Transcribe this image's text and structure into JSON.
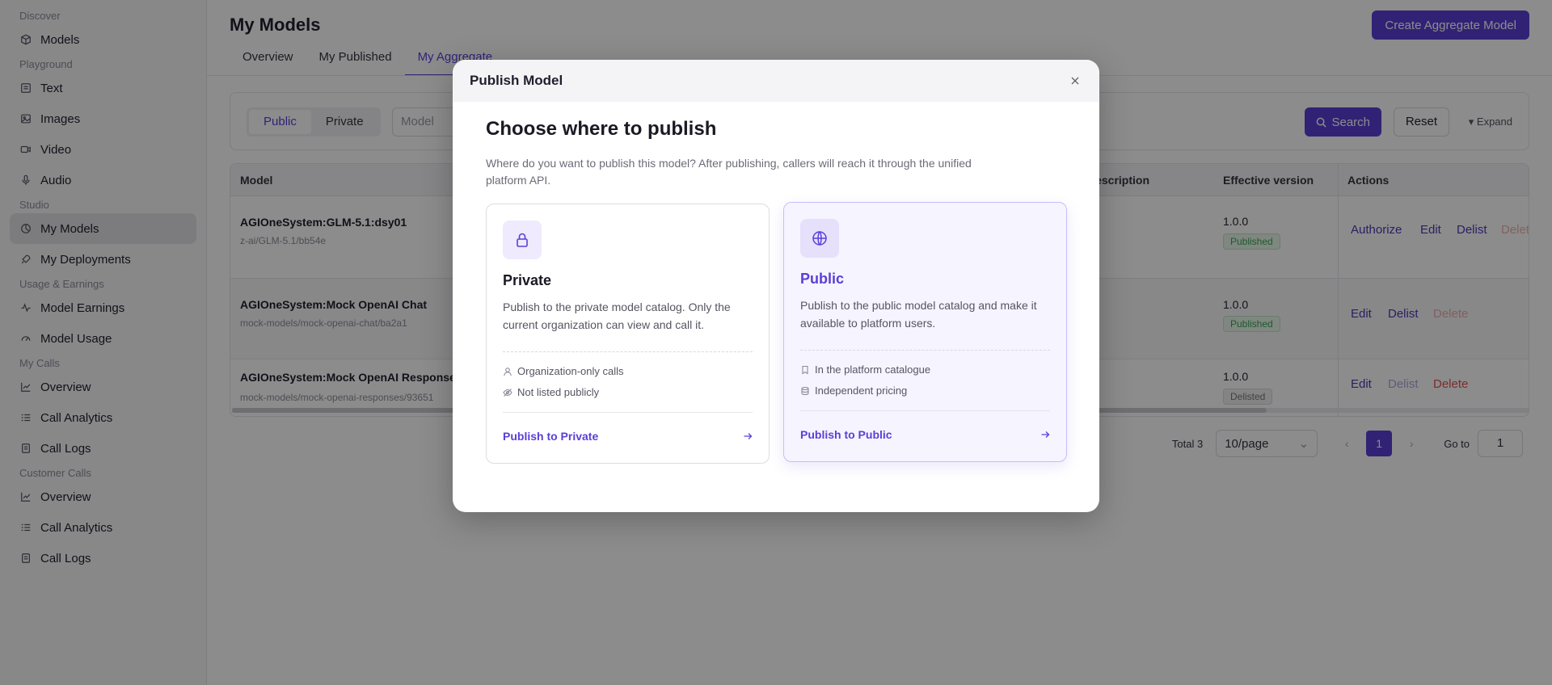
{
  "sidebar": {
    "groups": [
      {
        "title": "Discover",
        "items": [
          {
            "label": "Models",
            "icon": "cube-icon"
          }
        ]
      },
      {
        "title": "Playground",
        "items": [
          {
            "label": "Text",
            "icon": "text-icon"
          },
          {
            "label": "Images",
            "icon": "image-icon"
          },
          {
            "label": "Video",
            "icon": "video-icon"
          },
          {
            "label": "Audio",
            "icon": "mic-icon"
          }
        ]
      },
      {
        "title": "Studio",
        "items": [
          {
            "label": "My Models",
            "icon": "model-icon"
          },
          {
            "label": "My Deployments",
            "icon": "rocket-icon"
          }
        ]
      },
      {
        "title": "Usage & Earnings",
        "items": [
          {
            "label": "Model Earnings",
            "icon": "pulse-icon"
          },
          {
            "label": "Model Usage",
            "icon": "gauge-icon"
          }
        ]
      },
      {
        "title": "My Calls",
        "items": [
          {
            "label": "Overview",
            "icon": "trend-icon"
          },
          {
            "label": "Call Analytics",
            "icon": "list-icon"
          },
          {
            "label": "Call Logs",
            "icon": "logs-icon"
          }
        ]
      },
      {
        "title": "Customer Calls",
        "items": [
          {
            "label": "Overview",
            "icon": "trend-icon"
          },
          {
            "label": "Call Analytics",
            "icon": "list-icon"
          },
          {
            "label": "Call Logs",
            "icon": "logs-icon"
          }
        ]
      }
    ]
  },
  "header": {
    "title": "My Models",
    "create_button": "Create Aggregate Model",
    "tabs": [
      {
        "label": "Overview"
      },
      {
        "label": "My Published"
      },
      {
        "label": "My Aggregate"
      }
    ]
  },
  "filter": {
    "segment": [
      "Public",
      "Private"
    ],
    "model_placeholder": "Model",
    "search": "Search",
    "reset": "Reset",
    "expand": "Expand"
  },
  "table": {
    "columns": {
      "model": "Model",
      "description": "Description",
      "version": "Effective version",
      "actions": "Actions"
    },
    "rows": [
      {
        "name": "AGIOneSystem:GLM-5.1:dsy01",
        "path": "z-ai/GLM-5.1/bb54e",
        "version": "1.0.0",
        "status": "Published",
        "actions": [
          "Authorize",
          "Edit",
          "Delist",
          "Delete"
        ]
      },
      {
        "name": "AGIOneSystem:Mock OpenAI Chat",
        "path": "mock-models/mock-openai-chat/ba2a1",
        "version": "1.0.0",
        "status": "Published",
        "actions": [
          "Edit",
          "Delist",
          "Delete"
        ]
      },
      {
        "name": "AGIOneSystem:Mock OpenAI Responses",
        "path": "mock-models/mock-openai-responses/93651",
        "version": "1.0.0",
        "status": "Delisted",
        "actions": [
          "Edit",
          "Delist",
          "Delete"
        ]
      }
    ]
  },
  "pagination": {
    "total": "Total 3",
    "page_size": "10/page",
    "current": "1",
    "goto_label": "Go to",
    "goto_value": "1"
  },
  "modal": {
    "title": "Publish Model",
    "heading": "Choose where to publish",
    "description": "Where do you want to publish this model? After publishing, callers will reach it through the unified platform API.",
    "options": [
      {
        "title": "Private",
        "icon": "lock-icon",
        "description": "Publish to the private model catalog. Only the current organization can view and call it.",
        "features": [
          "Organization-only calls",
          "Not listed publicly"
        ],
        "cta": "Publish to Private"
      },
      {
        "title": "Public",
        "icon": "globe-icon",
        "description": "Publish to the public model catalog and make it available to platform users.",
        "features": [
          "In the platform catalogue",
          "Independent pricing"
        ],
        "cta": "Publish to Public"
      }
    ]
  },
  "colors": {
    "accent": "#5b3fd6",
    "danger": "#e25050",
    "success": "#3aa456"
  }
}
